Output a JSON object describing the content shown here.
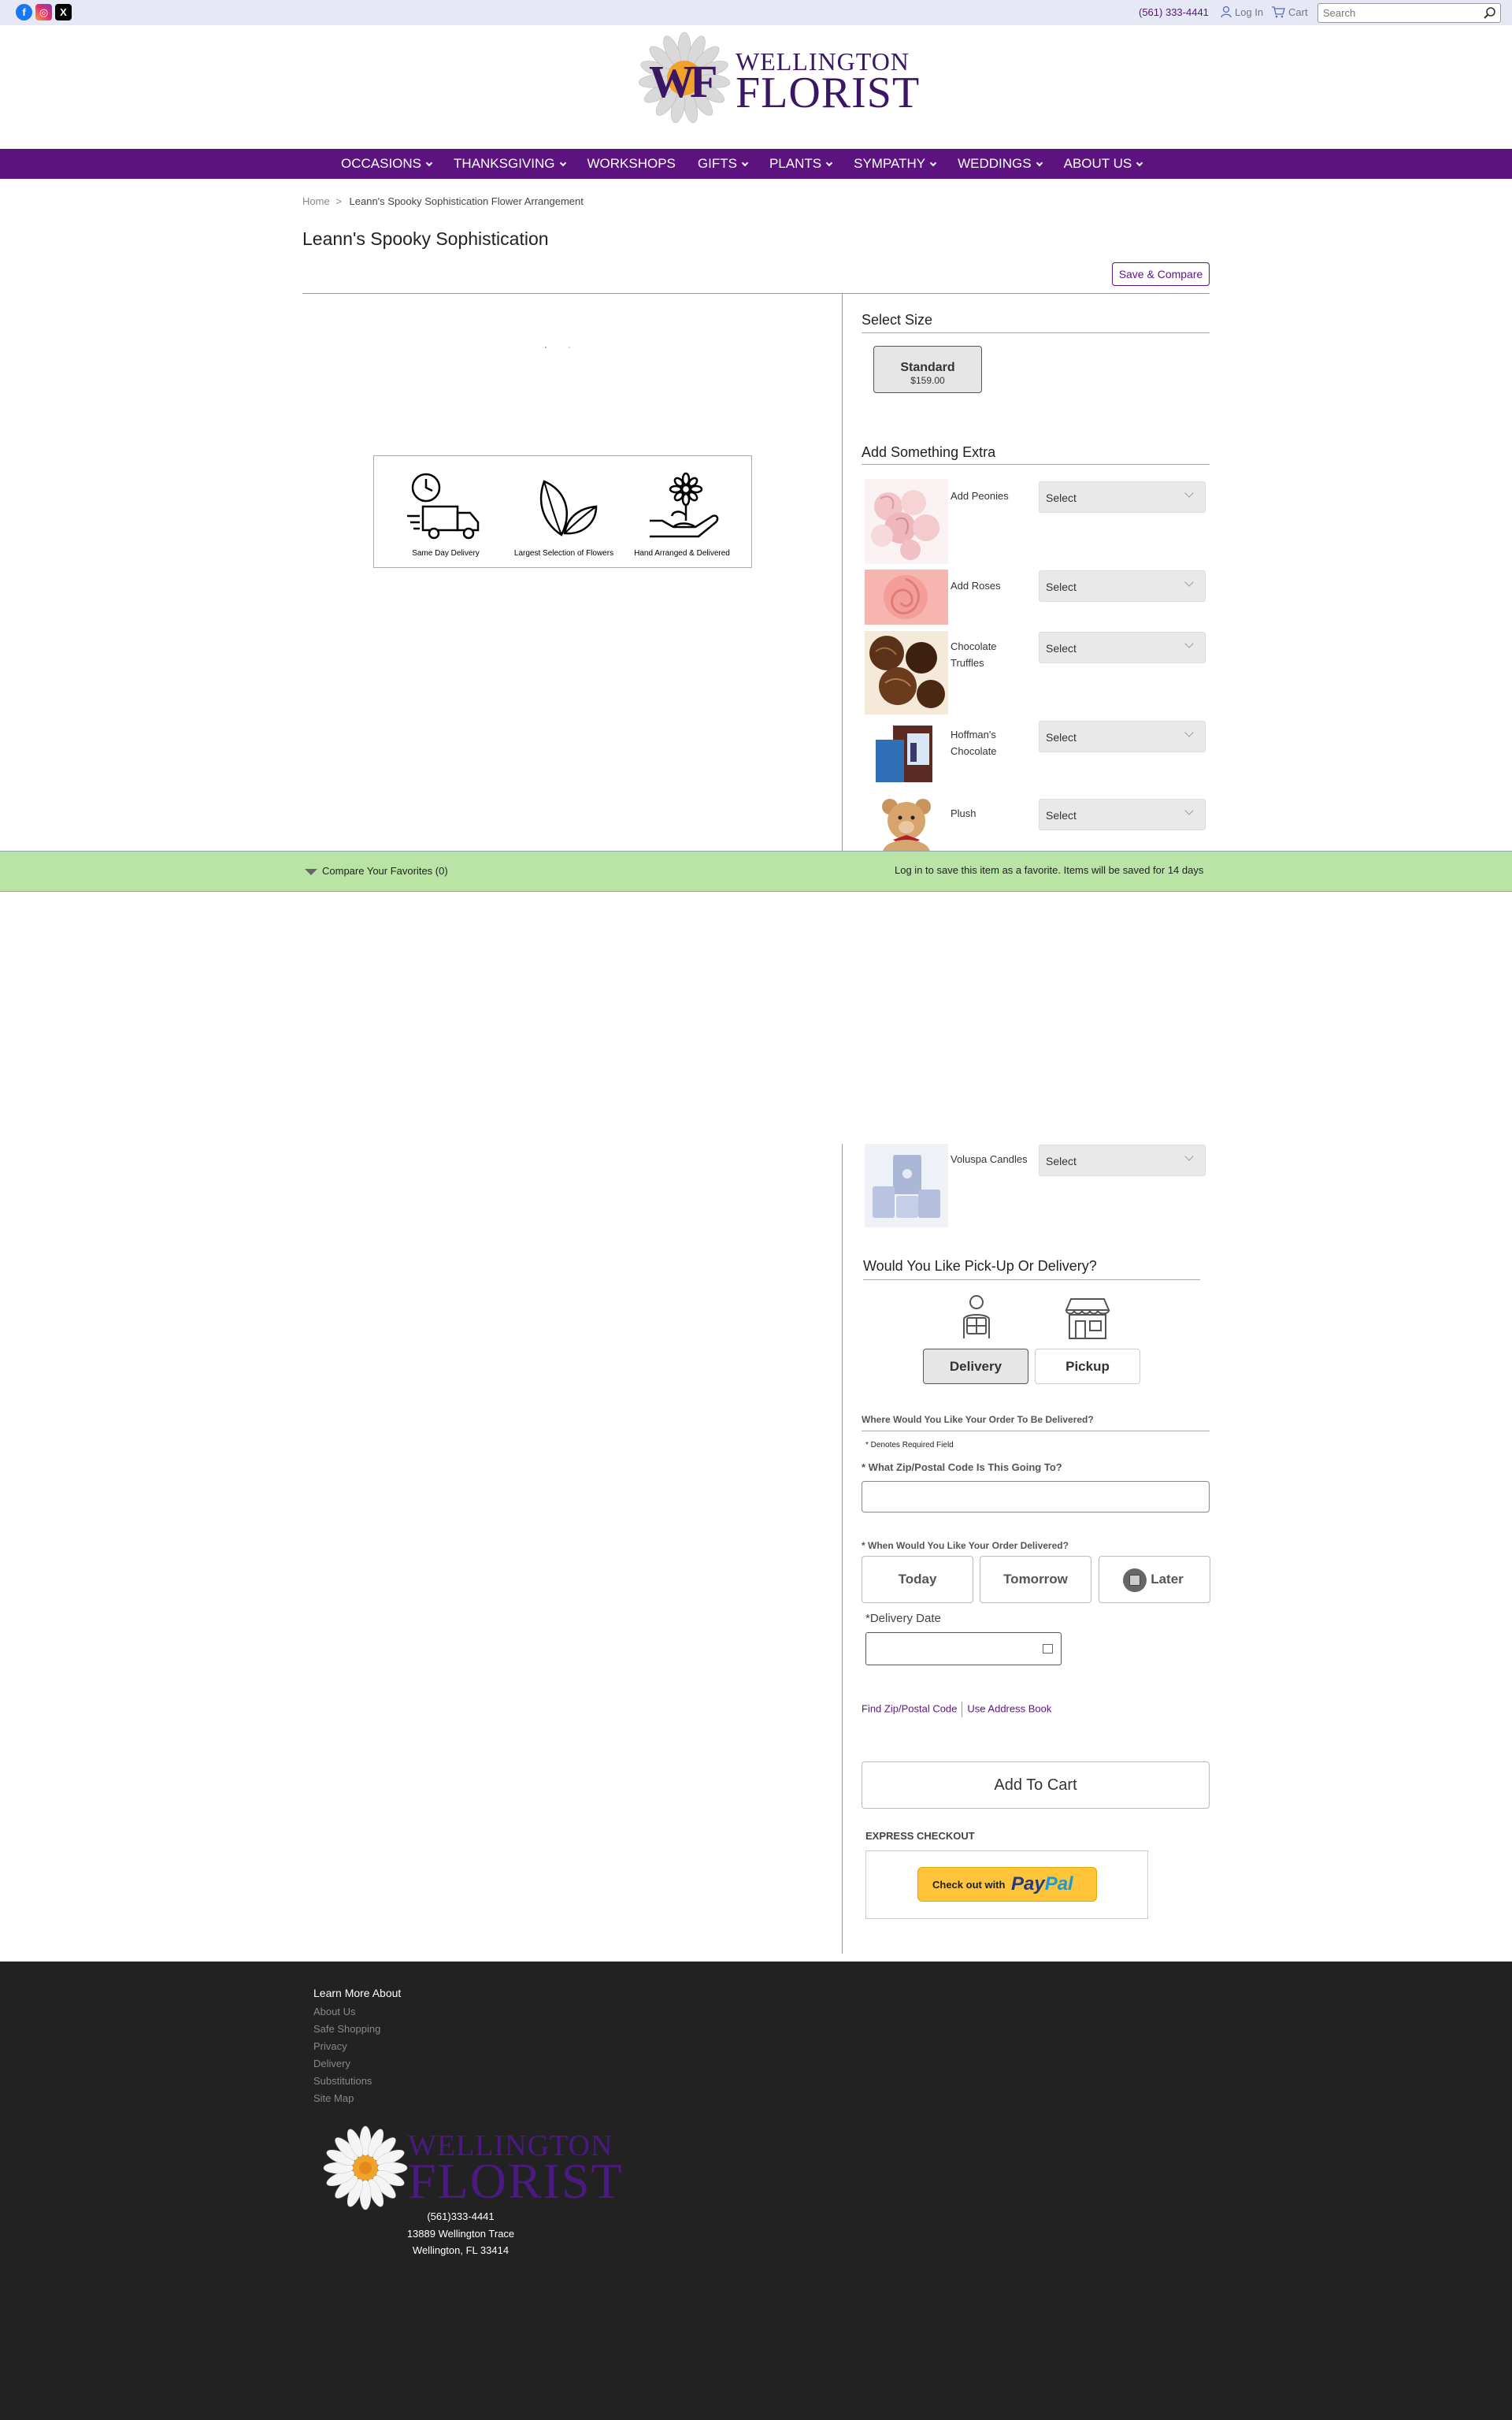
{
  "topbar": {
    "phone": "(561) 333-4441",
    "login": "Log In",
    "cart": "Cart",
    "search_placeholder": "Search"
  },
  "logo": {
    "monogram": "WF",
    "line1": "WELLINGTON",
    "line2": "FLORIST"
  },
  "nav": {
    "items": [
      {
        "label": "OCCASIONS",
        "chevron": true
      },
      {
        "label": "THANKSGIVING",
        "chevron": true
      },
      {
        "label": "WORKSHOPS",
        "chevron": false
      },
      {
        "label": "GIFTS",
        "chevron": true
      },
      {
        "label": "PLANTS",
        "chevron": true
      },
      {
        "label": "SYMPATHY",
        "chevron": true
      },
      {
        "label": "WEDDINGS",
        "chevron": true
      },
      {
        "label": "ABOUT US",
        "chevron": true
      }
    ]
  },
  "breadcrumb": {
    "home": "Home",
    "separator": ">",
    "current": "Leann's Spooky Sophistication Flower Arrangement"
  },
  "product": {
    "title": "Leann's Spooky Sophistication",
    "save_compare": "Save & Compare"
  },
  "features": [
    {
      "icon": "delivery-truck-icon",
      "caption": "Same Day Delivery"
    },
    {
      "icon": "leaf-icon",
      "caption": "Largest Selection of Flowers"
    },
    {
      "icon": "hand-flower-icon",
      "caption": "Hand Arranged & Delivered"
    }
  ],
  "size": {
    "heading": "Select Size",
    "option_name": "Standard",
    "option_price": "$159.00"
  },
  "extras": {
    "heading": "Add Something Extra",
    "items": [
      {
        "label": "Add Peonies",
        "select": "Select"
      },
      {
        "label": "Add Roses",
        "select": "Select"
      },
      {
        "label": "Chocolate Truffles",
        "select": "Select"
      },
      {
        "label": "Hoffman's Chocolate",
        "select": "Select"
      },
      {
        "label": "Plush",
        "select": "Select"
      },
      {
        "label": "Voluspa Candles",
        "select": "Select"
      }
    ]
  },
  "compare_bar": {
    "label": "Compare Your Favorites (0)",
    "login_note": "Log in to save this item as a favorite. Items will be saved for 14 days"
  },
  "fulfillment": {
    "heading": "Would You Like Pick-Up Or Delivery?",
    "delivery": "Delivery",
    "pickup": "Pickup",
    "where_heading": "Where Would You Like Your Order To Be Delivered?",
    "required_note": "* Denotes Required Field",
    "zip_label": "* What Zip/Postal Code Is This Going To?",
    "when_label": "* When Would You Like Your Order Delivered?",
    "today": "Today",
    "tomorrow": "Tomorrow",
    "later": "Later",
    "date_label": "*Delivery Date",
    "find_zip": "Find Zip/Postal Code",
    "address_book": "Use Address Book",
    "add_to_cart": "Add To Cart",
    "express_checkout": "EXPRESS CHECKOUT",
    "paypal_prefix": "Check out with",
    "paypal_brand_a": "Pay",
    "paypal_brand_b": "Pal"
  },
  "footer": {
    "heading": "Learn More About",
    "links": [
      "About Us",
      "Safe Shopping",
      "Privacy",
      "Delivery",
      "Substitutions",
      "Site Map"
    ],
    "logo_line1": "WELLINGTON",
    "logo_line2": "FLORIST",
    "phone": "(561)333-4441",
    "address1": "13889 Wellington Trace",
    "address2": "Wellington, FL 33414"
  },
  "colors": {
    "brand_purple": "#5c1380",
    "compare_green": "#b9e4a5",
    "footer_bg": "#222222",
    "paypal_yellow": "#ffc439"
  }
}
